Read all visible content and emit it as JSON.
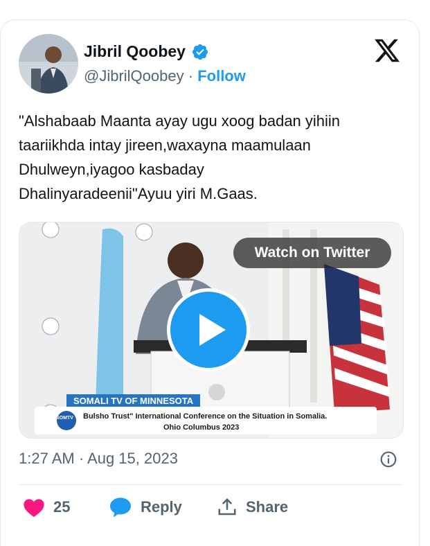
{
  "author": {
    "name": "Jibril Qoobey",
    "handle": "@JibrilQoobey",
    "separator": "·",
    "follow_label": "Follow"
  },
  "tweet": {
    "text": "\"Alshabaab Maanta ayay ugu xoog badan yihiin\ntaariikhda intay jireen,waxayna maamulaan\nDhulweyn,iyagoo kasbaday\nDhalinyaradeenii\"Ayuu yiri M.Gaas."
  },
  "media": {
    "watch_label": "Watch on Twitter",
    "banner_channel": "SOMALI TV OF MINNESOTA",
    "banner_line1": "Bulsho Trust\" International Conference on the Situation in Somalia.",
    "banner_line2": "Ohio Columbus 2023",
    "logo_badge": "SOMTV"
  },
  "meta": {
    "timestamp": "1:27 AM · Aug 15, 2023"
  },
  "actions": {
    "like_count": "25",
    "reply_label": "Reply",
    "share_label": "Share"
  },
  "colors": {
    "accent": "#1d9bf0",
    "like": "#f91880",
    "text_primary": "#0f1419",
    "text_secondary": "#536471"
  },
  "icons": {
    "verified": "verified-badge-icon",
    "brand": "x-logo-icon",
    "info": "info-icon",
    "like": "heart-icon",
    "reply": "speech-bubble-icon",
    "share": "share-upload-icon",
    "play": "play-icon"
  }
}
